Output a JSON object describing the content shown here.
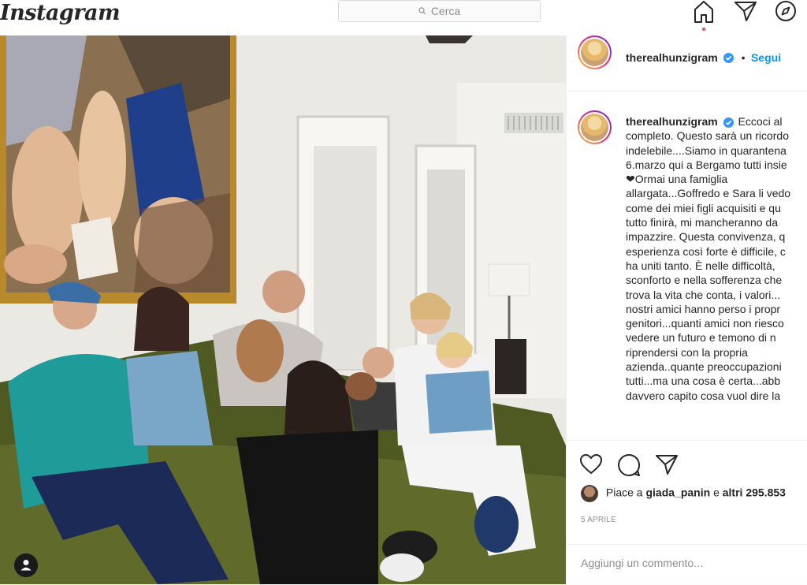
{
  "topbar": {
    "logo": "Instagram",
    "search_placeholder": "Cerca",
    "icons": [
      "home-icon",
      "direct-icon",
      "explore-icon"
    ]
  },
  "post": {
    "author": "therealhunzigram",
    "follow_label": "Segui",
    "separator": "•",
    "caption_lines": [
      "Eccoci al",
      "completo. Questo sarà un ricordo",
      "indelebile....Siamo in quarantena",
      "6.marzo qui a Bergamo tutti insie",
      "❤Ormai una famiglia",
      "allargata...Goffredo e Sara li vedo",
      "come dei miei figli acquisiti e qu",
      "tutto finirà, mi mancheranno da",
      "impazzire. Questa convivenza, q",
      "esperienza così forte è difficile, c",
      "ha uniti tanto. È nelle difficoltà,",
      "sconforto e nella sofferenza che",
      "trova la vita che conta, i valori...",
      "nostri amici hanno perso i propr",
      "genitori...quanti amici non riesco",
      "vedere un futuro e temono di n",
      "riprendersi con la propria",
      "azienda..quante preoccupazioni",
      "tutti...ma una cosa è certa...abb",
      "davvero capito cosa vuol dire la"
    ],
    "likes_prefix": "Piace a",
    "likes_user": "giada_panin",
    "likes_middle": "e",
    "likes_others": "altri 295.853",
    "date": "5 APRILE",
    "comment_placeholder": "Aggiungi un commento..."
  },
  "colors": {
    "accent": "#0095f6",
    "notification_dot": "#ed4956",
    "verified": "#3897f0"
  }
}
